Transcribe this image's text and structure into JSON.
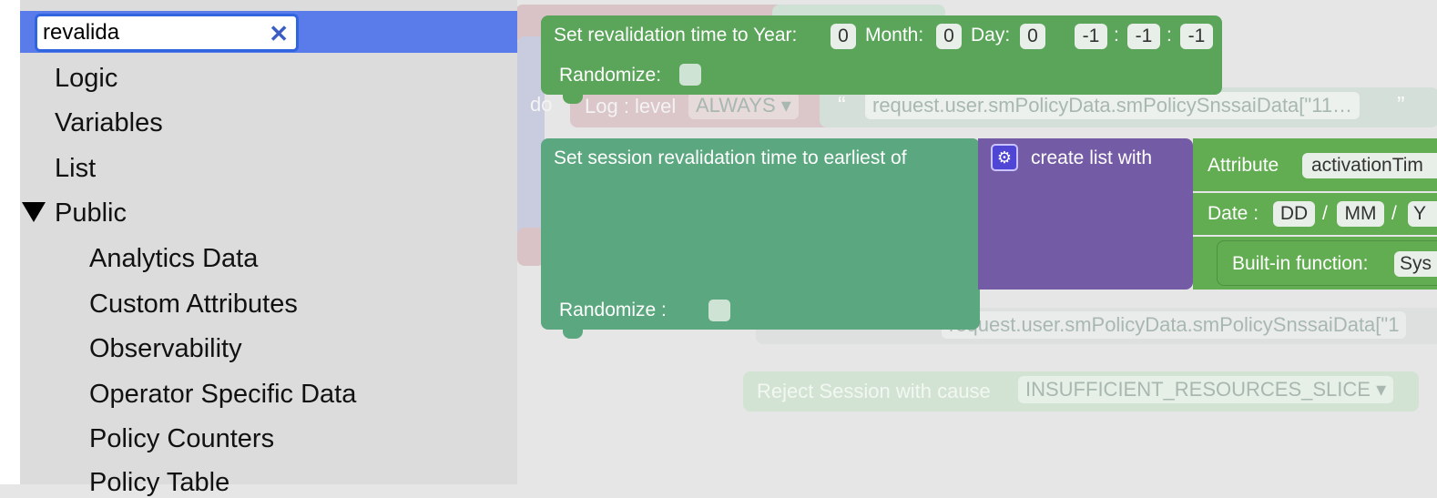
{
  "search": {
    "value": "revalida",
    "clear_glyph": "✕"
  },
  "toolbox": {
    "categories": [
      {
        "label": "Logic"
      },
      {
        "label": "Variables"
      },
      {
        "label": "List"
      },
      {
        "label": "Public",
        "expanded": true
      },
      {
        "label": "Analytics Data"
      },
      {
        "label": "Custom Attributes"
      },
      {
        "label": "Observability"
      },
      {
        "label": "Operator Specific Data"
      },
      {
        "label": "Policy Counters"
      },
      {
        "label": "Policy Table"
      }
    ],
    "expand_icon": "triangle-down-icon"
  },
  "workspace": {
    "bg_do": "do",
    "bg_log": "Log : level",
    "bg_level": "ALWAYS ▾",
    "bg_quote_open": "“",
    "bg_quote_close": "”",
    "bg_request1": "request.user.smPolicyData.smPolicySnssaiData[\"11…",
    "bg_request2": "request.user.smPolicyData.smPolicySnssaiData[\"1",
    "bg_reject": "Reject Session with cause",
    "bg_cause": "INSUFFICIENT_RESOURCES_SLICE ▾",
    "block1": {
      "text1": "Set revalidation time to Year:",
      "year": "0",
      "month_label": "Month:",
      "month": "0",
      "day_label": "Day:",
      "day": "0",
      "h": "-1",
      "m": "-1",
      "s": "-1",
      "colon": ":",
      "randomize": "Randomize:"
    },
    "block2": {
      "text": "Set session revalidation time to earliest of",
      "randomize": "Randomize :"
    },
    "list_block": {
      "label": "create list with",
      "gear_icon": "gear-icon"
    },
    "attr_block": {
      "label": "Attribute",
      "value": "activationTim"
    },
    "date_block": {
      "label": "Date :",
      "dd": "DD",
      "mm": "MM",
      "sep": "/",
      "yy": "Y"
    },
    "builtin_block": {
      "label": "Built-in function:",
      "value": "Sys"
    }
  },
  "colors": {
    "search_row": "#5a7bea",
    "block_green": "#5ba55b",
    "block_teal": "#5ba77f",
    "list_purple": "#745ba5",
    "toolbox_bg": "#dcdcdc"
  }
}
